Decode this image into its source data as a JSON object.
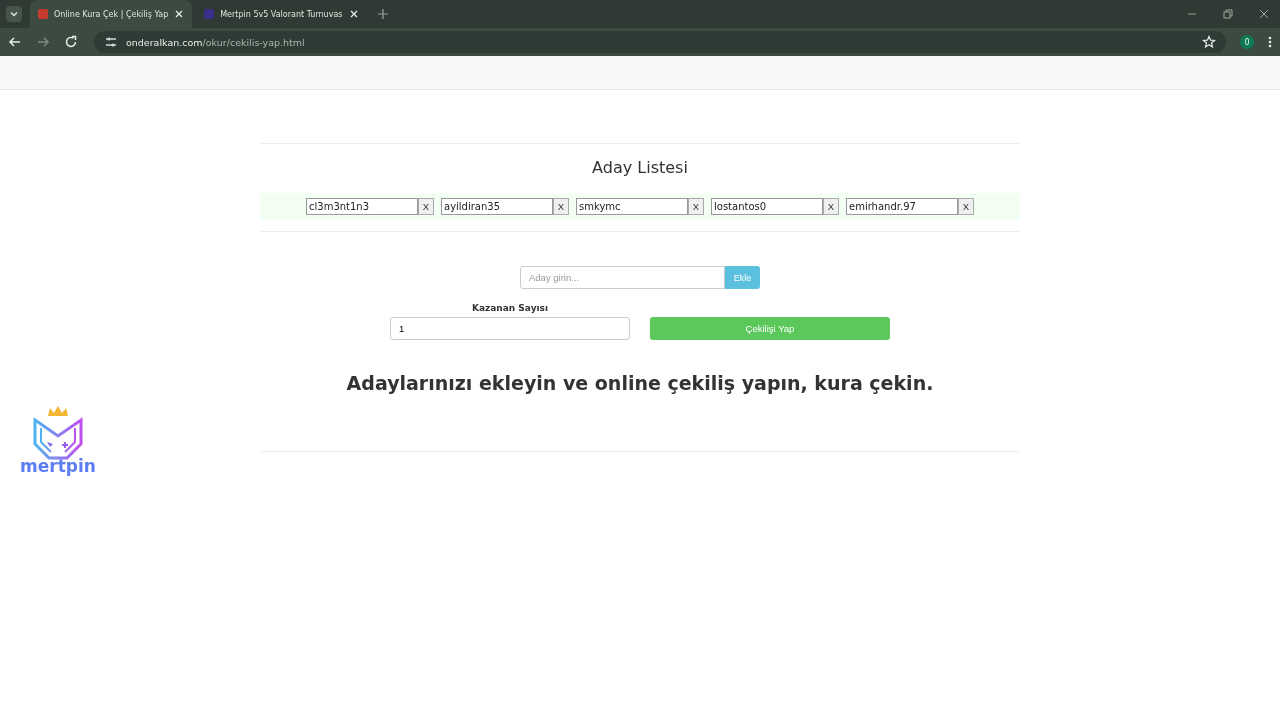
{
  "browser": {
    "tabs": [
      {
        "title": "Online Kura Çek | Çekiliş Yap",
        "selected": true
      },
      {
        "title": "Mertpin 5v5 Valorant Turnuvas",
        "selected": false
      }
    ],
    "address": {
      "domain": "onderalkan.com",
      "path": "/okur/cekilis-yap.html"
    },
    "profile_badge": "0"
  },
  "page": {
    "list_title": "Aday Listesi",
    "candidates": [
      {
        "name": "cl3m3nt1n3",
        "remove": "X"
      },
      {
        "name": "ayildiran35",
        "remove": "X"
      },
      {
        "name": "smkymc",
        "remove": "X"
      },
      {
        "name": "lostantos0",
        "remove": "X"
      },
      {
        "name": "emirhandr.97",
        "remove": "X"
      }
    ],
    "add_field": {
      "placeholder": "Aday girin..."
    },
    "add_button": "Ekle",
    "winner_label": "Kazanan Sayısı",
    "winner_count": "1",
    "draw_button": "Çekilişi Yap",
    "headline": "Adaylarınızı ekleyin ve online çekiliş yapın, kura çekin."
  },
  "overlay_logo": {
    "text": "mertpin"
  }
}
